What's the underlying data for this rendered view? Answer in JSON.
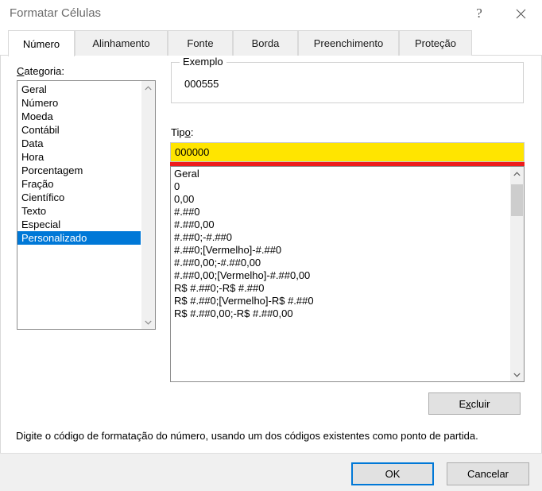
{
  "window": {
    "title": "Formatar Células",
    "help_icon": "question-mark-icon",
    "close_icon": "close-icon"
  },
  "tabs": [
    {
      "label": "Número",
      "active": true
    },
    {
      "label": "Alinhamento",
      "active": false
    },
    {
      "label": "Fonte",
      "active": false
    },
    {
      "label": "Borda",
      "active": false
    },
    {
      "label": "Preenchimento",
      "active": false
    },
    {
      "label": "Proteção",
      "active": false
    }
  ],
  "category": {
    "label_prefix": "C",
    "label_rest": "ategoria:",
    "items": [
      "Geral",
      "Número",
      "Moeda",
      "Contábil",
      "Data",
      "Hora",
      "Porcentagem",
      "Fração",
      "Científico",
      "Texto",
      "Especial",
      "Personalizado"
    ],
    "selected": "Personalizado",
    "selected_index": 11
  },
  "exemplo": {
    "title": "Exemplo",
    "value": "000555"
  },
  "tipo": {
    "label_pre": "Tip",
    "label_key": "o",
    "label_post": ":",
    "value": "000000",
    "placeholder": "",
    "highlight_color": "#ffe500",
    "underline_color": "#ee1c1c"
  },
  "format_list": {
    "items": [
      "Geral",
      "0",
      "0,00",
      "#.##0",
      "#.##0,00",
      "#.##0;-#.##0",
      "#.##0;[Vermelho]-#.##0",
      "#.##0,00;-#.##0,00",
      "#.##0,00;[Vermelho]-#.##0,00",
      "R$ #.##0;-R$ #.##0",
      "R$ #.##0;[Vermelho]-R$ #.##0",
      "R$ #.##0,00;-R$ #.##0,00"
    ]
  },
  "buttons": {
    "excluir_pre": "E",
    "excluir_key": "x",
    "excluir_post": "cluir",
    "ok": "OK",
    "cancelar": "Cancelar"
  },
  "hint": "Digite o código de formatação do número, usando um dos códigos existentes como ponto de partida.",
  "colors": {
    "accent": "#0078d7",
    "highlight": "#ffe500",
    "error": "#ee1c1c",
    "button_face": "#e1e1e1"
  }
}
